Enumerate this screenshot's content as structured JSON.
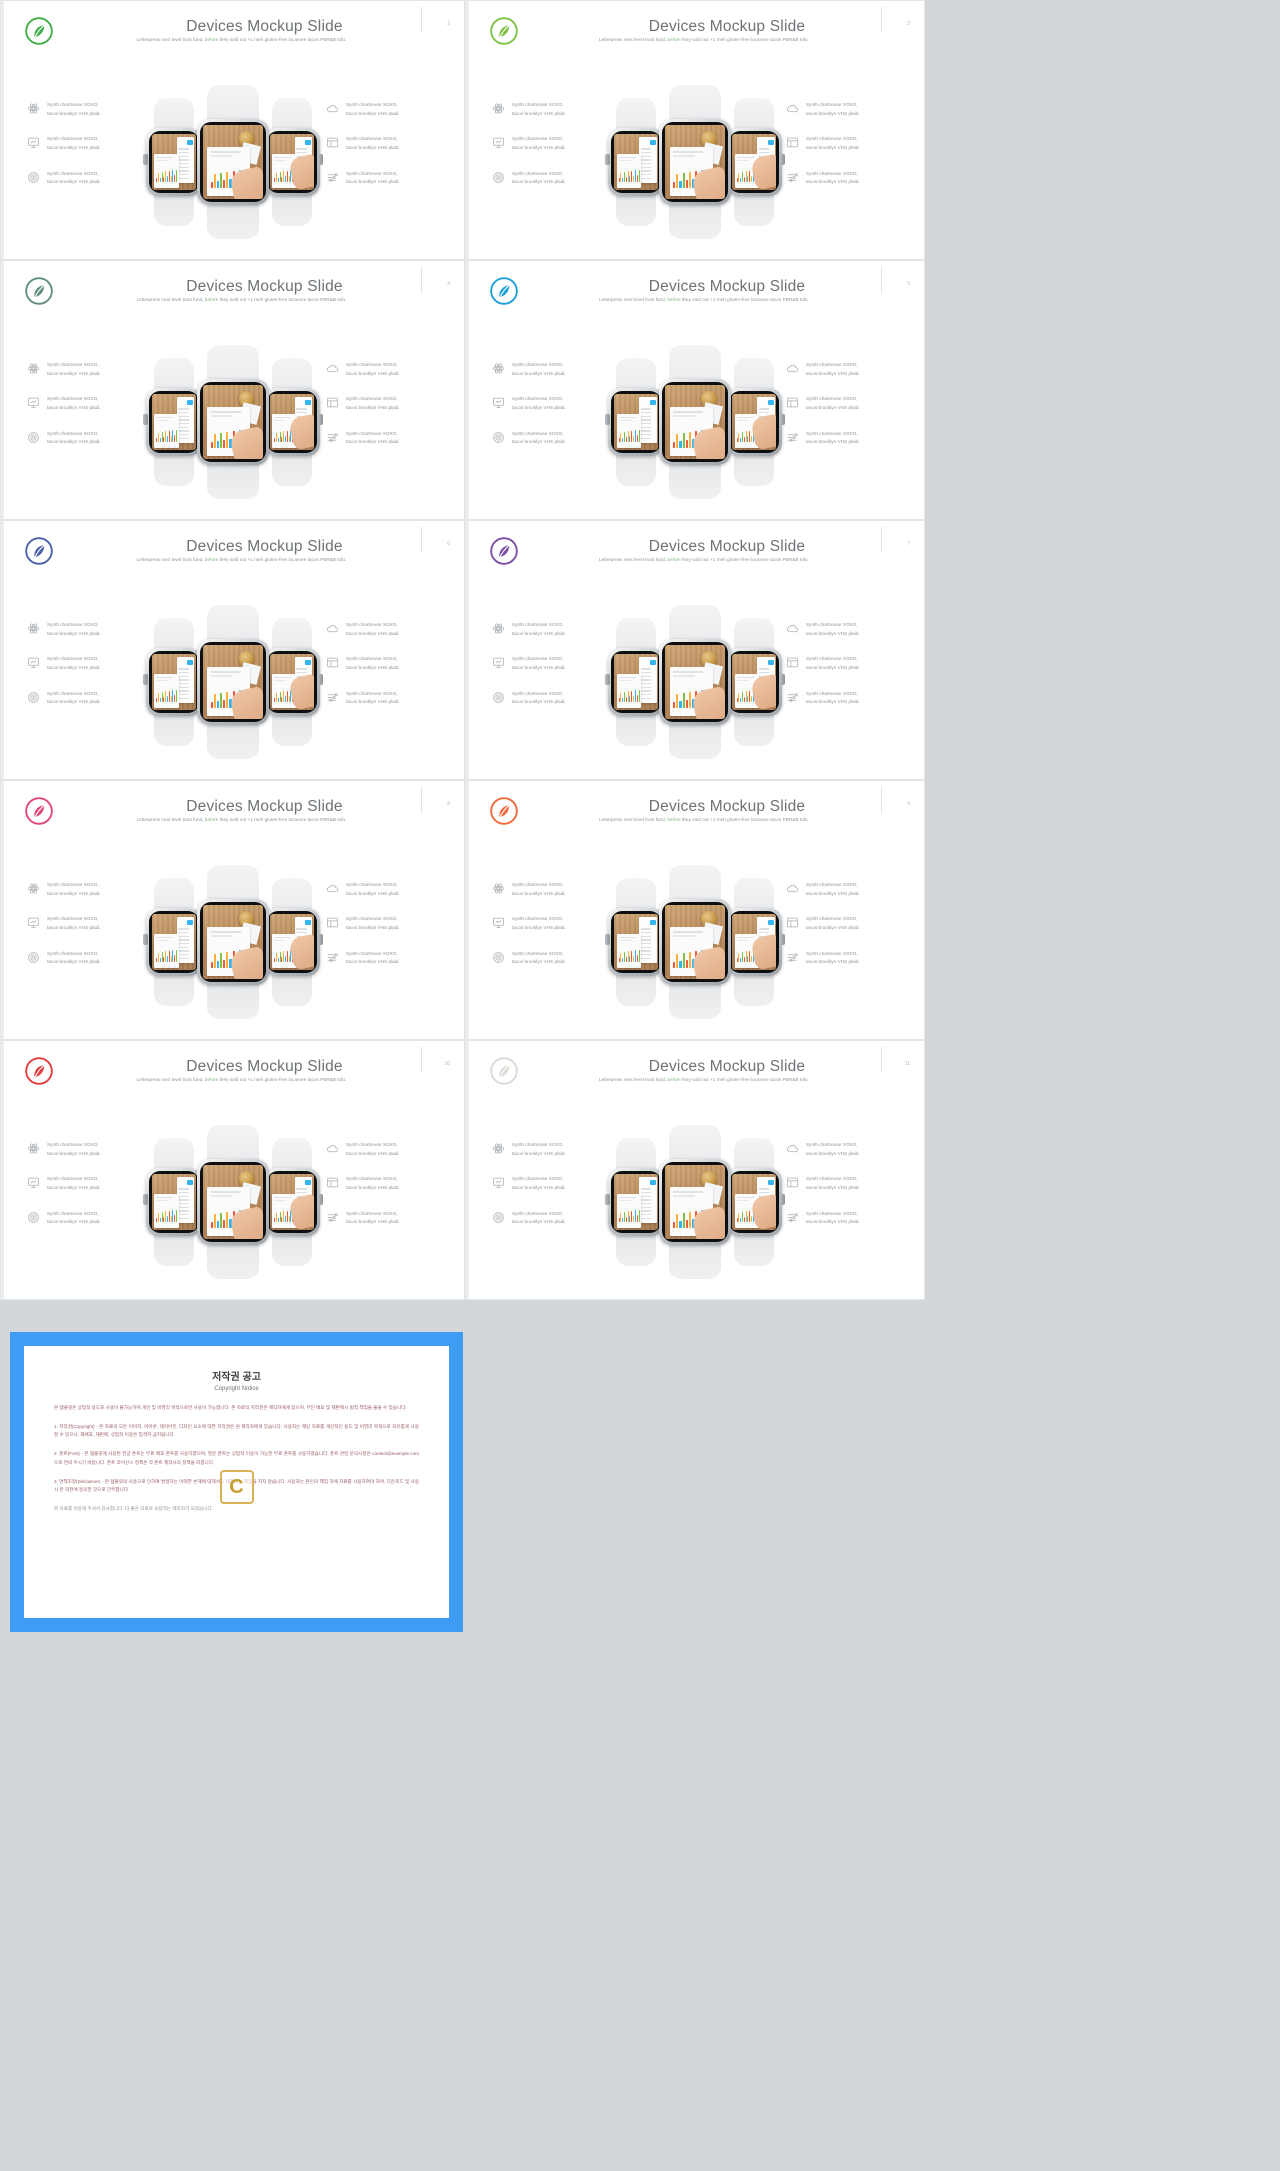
{
  "deck": {
    "title": "Devices Mockup Slide",
    "subtitle_before": "Letterpress next level trust fund, ",
    "subtitle_highlight": "before",
    "subtitle_after": " they sold out +1 meh gluten-free locavore tacos PBR&B tofu.",
    "feature_text_line1": "Synth chartreuse XOXO,",
    "feature_text_line2": "tacos brooklyn VHS plaid.",
    "left_icons": [
      "atom-icon",
      "presentation-chart-icon",
      "target-icon"
    ],
    "right_icons": [
      "cloud-icon",
      "grid-layout-icon",
      "sliders-icon"
    ]
  },
  "slides": [
    {
      "page": "2",
      "logo_color": "#3fae49",
      "logo_name": "leaf-logo-green"
    },
    {
      "page": "3",
      "logo_color": "#7dc242",
      "logo_name": "leaf-logo-lime"
    },
    {
      "page": "4",
      "logo_color": "#5f8f80",
      "logo_name": "leaf-logo-teal-gray"
    },
    {
      "page": "5",
      "logo_color": "#1f9fd8",
      "logo_name": "leaf-logo-blue"
    },
    {
      "page": "6",
      "logo_color": "#4b5fa8",
      "logo_name": "leaf-logo-indigo"
    },
    {
      "page": "7",
      "logo_color": "#7b4fa8",
      "logo_name": "leaf-logo-purple"
    },
    {
      "page": "8",
      "logo_color": "#e0457b",
      "logo_name": "leaf-logo-pink"
    },
    {
      "page": "9",
      "logo_color": "#f06a3c",
      "logo_name": "leaf-logo-orange"
    },
    {
      "page": "10",
      "logo_color": "#e23b3b",
      "logo_name": "leaf-logo-red"
    },
    {
      "page": "11",
      "logo_color": "#d8dcd2",
      "logo_name": "leaf-logo-pale"
    }
  ],
  "copyright": {
    "title": "저작권 공고",
    "subtitle": "Copyright Notice",
    "intro": "본 템플릿은 상업적 용도로 사용이 불가능하며 개인 및 비영리 목적으로만 사용이 가능합니다. 본 자료의 저작권은 제작자에게 있으며, 무단 배포 및 재판매시 법적 책임을 물을 수 있습니다.",
    "p1": "1. 저작권(Copyright) - 본 자료의 모든 이미지, 아이콘, 레이아웃, 디자인 요소에 대한 저작권은 원 제작자에게 있습니다. 사용자는 해당 자료를 개인적인 용도 및 비영리 목적으로 자유롭게 사용할 수 있으나, 재배포, 재판매, 상업적 이용은 엄격히 금지됩니다.",
    "p2": "2. 폰트(Font) - 본 템플릿에 사용된 한글 폰트는 무료 배포 폰트를 사용하였으며, 영문 폰트는 상업적 이용이 가능한 무료 폰트를 사용하였습니다. 폰트 관련 문의사항은 contact@example.com 으로 연락 주시기 바랍니다. 폰트 라이선스 정책은 각 폰트 제작사의 정책을 따릅니다.",
    "p3": "3. 면책조항(Disclaimer) - 본 템플릿의 사용으로 인하여 발생하는 어떠한 손해에 대해서도 제작자는 책임을 지지 않습니다. 사용자는 본인의 책임 하에 자료를 사용하여야 하며, 다운로드 및 사용 시 본 약관에 동의한 것으로 간주합니다.",
    "outro": "본 자료를 이용해 주셔서 감사합니다. 더 좋은 자료로 보답하는 제작자가 되겠습니다.",
    "watermark": "C",
    "border_color": "#3e9cf5"
  }
}
